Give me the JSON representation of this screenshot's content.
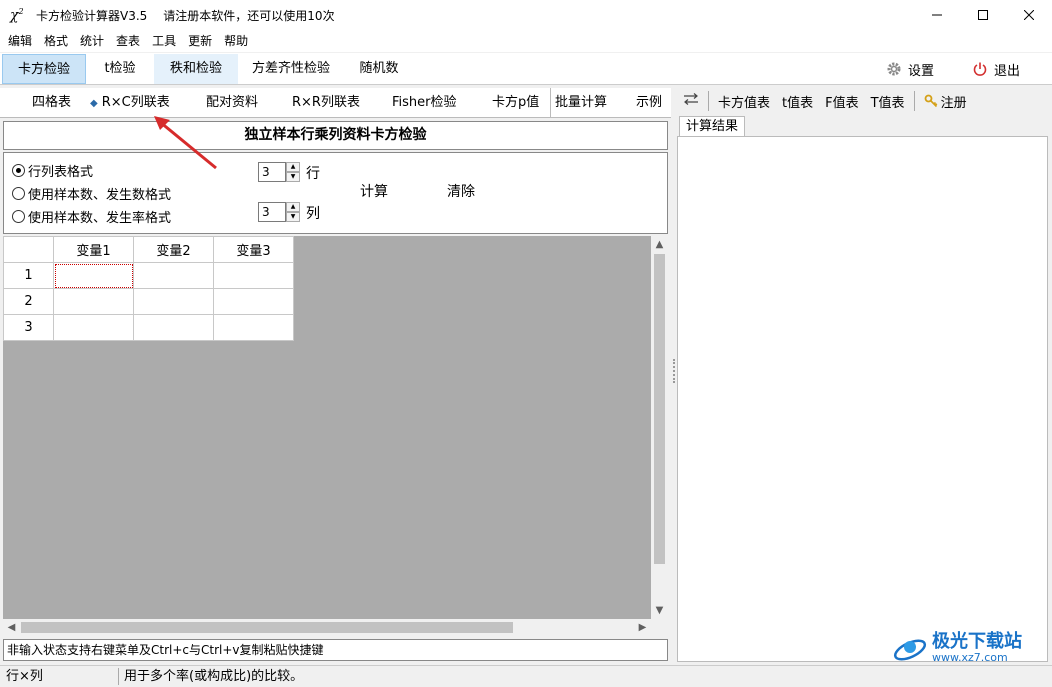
{
  "window": {
    "title": "卡方检验计算器V3.5",
    "notice": "请注册本软件，还可以使用10次",
    "icon_text": "χ²"
  },
  "menu": [
    "编辑",
    "格式",
    "统计",
    "查表",
    "工具",
    "更新",
    "帮助"
  ],
  "main_tabs": [
    "卡方检验",
    "t检验",
    "秩和检验",
    "方差齐性检验",
    "随机数"
  ],
  "main_toolbar": {
    "settings": "设置",
    "exit": "退出"
  },
  "sub_tabs": [
    "四格表",
    "R×C列联表",
    "配对资料",
    "R×R列联表",
    "Fisher检验",
    "卡方p值",
    "批量计算",
    "示例"
  ],
  "panel_title": "独立样本行乘列资料卡方检验",
  "options": {
    "radios": [
      "行列表格式",
      "使用样本数、发生数格式",
      "使用样本数、发生率格式"
    ],
    "selected_index": 0,
    "rows_value": "3",
    "rows_label": "行",
    "cols_value": "3",
    "cols_label": "列",
    "calc": "计算",
    "clear": "清除"
  },
  "grid": {
    "headers": [
      "变量1",
      "变量2",
      "变量3"
    ],
    "row_labels": [
      "1",
      "2",
      "3"
    ]
  },
  "hint": "非输入状态支持右键菜单及Ctrl+c与Ctrl+v复制粘贴快捷键",
  "right_toolbar": [
    "卡方值表",
    "t值表",
    "F值表",
    "T值表",
    "注册"
  ],
  "right_tab": "计算结果",
  "status": {
    "left": "行×列",
    "right": "用于多个率(或构成比)的比较。"
  },
  "watermark": {
    "main": "极光下载站",
    "sub": "www.xz7.com"
  },
  "colors": {
    "active_tab": "#cce4f7",
    "accent": "#2b6aa8",
    "arrow": "#d62b2b",
    "exit_icon": "#d32f2f"
  }
}
